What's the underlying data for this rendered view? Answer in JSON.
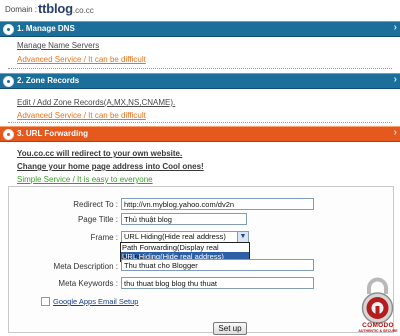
{
  "domain": {
    "label": "Domain :",
    "name": "ttblog",
    "tld": ".co.cc"
  },
  "sections": [
    {
      "number_title": "1. Manage DNS",
      "link": "Manage Name Servers",
      "note": "Advanced Service / It can be difficult"
    },
    {
      "number_title": "2. Zone Records",
      "link": "Edit / Add Zone Records(A,MX,NS,CNAME).",
      "note": "Advanced Service / It can be difficult"
    },
    {
      "number_title": "3. URL Forwarding",
      "desc_lines": [
        "You.co.cc will redirect to your own website.",
        "Change your home page address into Cool ones!"
      ],
      "note": "Simple Service / It is easy to everyone"
    }
  ],
  "form": {
    "redirect_label": "Redirect To :",
    "redirect_value": "http://vn.myblog.yahoo.com/dv2n",
    "title_label": "Page Title :",
    "title_value": "Thủ thuật blog",
    "frame_label": "Frame :",
    "frame_selected": "URL Hiding(Hide real address)",
    "frame_options": [
      "Path Forwarding(Display real address)",
      "URL Hiding(Hide real address)"
    ],
    "meta_desc_label": "Meta Description :",
    "meta_desc_value": "Thu thuat cho Blogger",
    "meta_kw_label": "Meta Keywords :",
    "meta_kw_value": "thu thuat blog blog thu thuat",
    "gapps_label": "Google Apps Email Setup",
    "setup_button": "Set up"
  },
  "badge": {
    "brand": "COMODO",
    "tagline": "AUTHENTIC & SECURE"
  },
  "colors": {
    "section_blue": "#1d6f9b",
    "section_active": "#e55a1c",
    "advanced_note": "#e8731d",
    "simple_note": "#3a9c2a"
  },
  "icons": [
    "bullet-dot-icon",
    "chevron-icon",
    "dropdown-arrow-icon",
    "comodo-padlock-icon"
  ]
}
